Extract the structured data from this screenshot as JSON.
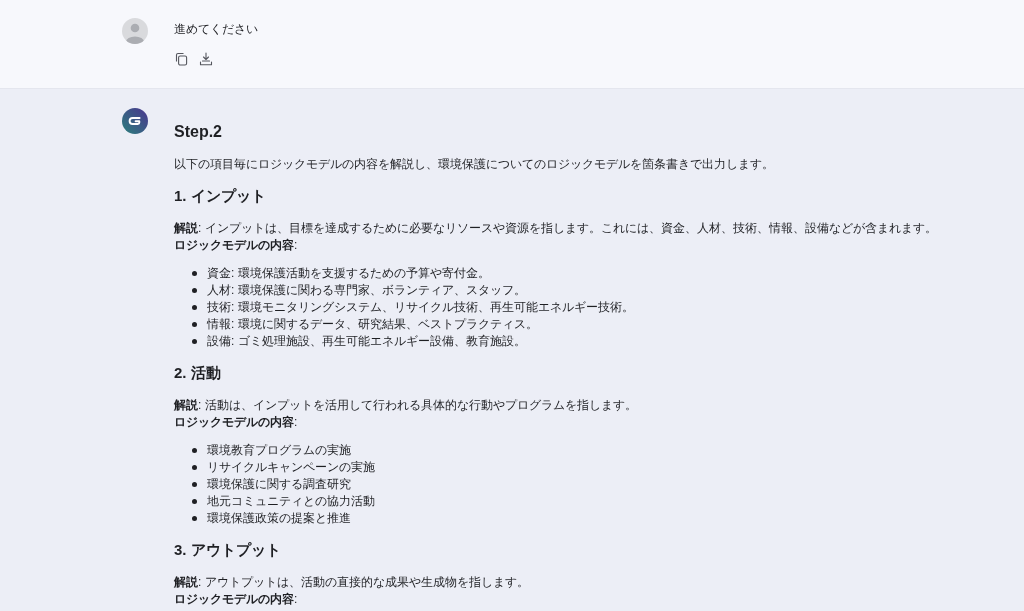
{
  "user_message": {
    "text": "進めてください"
  },
  "assistant_message": {
    "title": "Step.2",
    "intro": "以下の項目毎にロジックモデルの内容を解説し、環境保護についてのロジックモデルを箇条書きで出力します。",
    "sections": [
      {
        "heading": "1. インプット",
        "description": "**解説**: インプットは、目標を達成するために必要なリソースや資源を指します。これには、資金、人材、技術、情報、設備などが含まれます。",
        "list_label": "**ロジックモデルの内容**:",
        "items": [
          "資金: 環境保護活動を支援するための予算や寄付金。",
          "人材: 環境保護に関わる専門家、ボランティア、スタッフ。",
          "技術: 環境モニタリングシステム、リサイクル技術、再生可能エネルギー技術。",
          "情報: 環境に関するデータ、研究結果、ベストプラクティス。",
          "設備: ゴミ処理施設、再生可能エネルギー設備、教育施設。"
        ]
      },
      {
        "heading": "2. 活動",
        "description": "**解説**: 活動は、インプットを活用して行われる具体的な行動やプログラムを指します。",
        "list_label": "**ロジックモデルの内容**:",
        "items": [
          "環境教育プログラムの実施",
          "リサイクルキャンペーンの実施",
          "環境保護に関する調査研究",
          "地元コミュニティとの協力活動",
          "環境保護政策の提案と推進"
        ]
      },
      {
        "heading": "3. アウトプット",
        "description": "**解説**: アウトプットは、活動の直接的な成果や生成物を指します。",
        "list_label": "**ロジックモデルの内容**:"
      }
    ]
  }
}
